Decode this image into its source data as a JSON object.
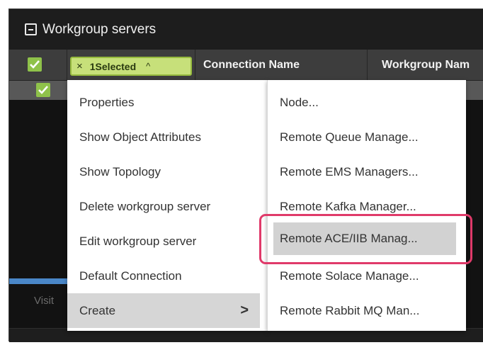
{
  "panel": {
    "title": "Workgroup servers"
  },
  "table": {
    "selection": {
      "close_glyph": "×",
      "label": "1Selected",
      "chevron": "^"
    },
    "columns": [
      "Connection Name",
      "Workgroup Nam"
    ],
    "row_checked": true,
    "status_fragment": "Visit"
  },
  "context_menu": {
    "items": [
      {
        "label": "Properties"
      },
      {
        "label": "Show Object Attributes"
      },
      {
        "label": "Show Topology"
      },
      {
        "label": "Delete workgroup server"
      },
      {
        "label": "Edit workgroup server"
      },
      {
        "label": "Default Connection"
      },
      {
        "label": "Create",
        "submenu_arrow": ">",
        "hovered": true
      }
    ]
  },
  "create_submenu": {
    "items": [
      {
        "label": "Node..."
      },
      {
        "label": "Remote Queue Manage..."
      },
      {
        "label": "Remote EMS Managers..."
      },
      {
        "label": "Remote Kafka Manager..."
      },
      {
        "label": "Remote ACE/IIB Manag...",
        "highlighted": true
      },
      {
        "label": "Remote Solace Manage..."
      },
      {
        "label": "Remote Rabbit MQ Man..."
      }
    ]
  },
  "colors": {
    "accent_green": "#8fc24a",
    "selected_pill": "#c7e07a",
    "highlight_annotation": "#e03a6a",
    "progress_blue": "#4a87c8"
  },
  "icons": [
    "collapse-icon",
    "checkmark-icon",
    "close-icon",
    "chevron-up-icon",
    "chevron-right-icon"
  ]
}
